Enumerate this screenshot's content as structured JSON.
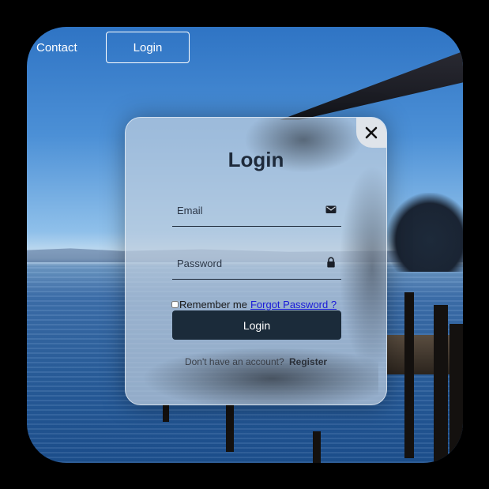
{
  "nav": {
    "contact_label": "Contact",
    "login_label": "Login"
  },
  "modal": {
    "title": "Login",
    "close_icon": "close-icon",
    "email": {
      "placeholder": "Email",
      "icon": "envelope-icon"
    },
    "password": {
      "placeholder": "Password",
      "icon": "lock-icon"
    },
    "remember_label": "Remember me",
    "forgot_label": "Forgot Password ?",
    "submit_label": "Login",
    "register_prompt": "Don't have an account?",
    "register_label": "Register"
  },
  "colors": {
    "card_text": "#1e2a3a",
    "button_bg": "#1b2b3a",
    "link": "#1a1ad8"
  }
}
